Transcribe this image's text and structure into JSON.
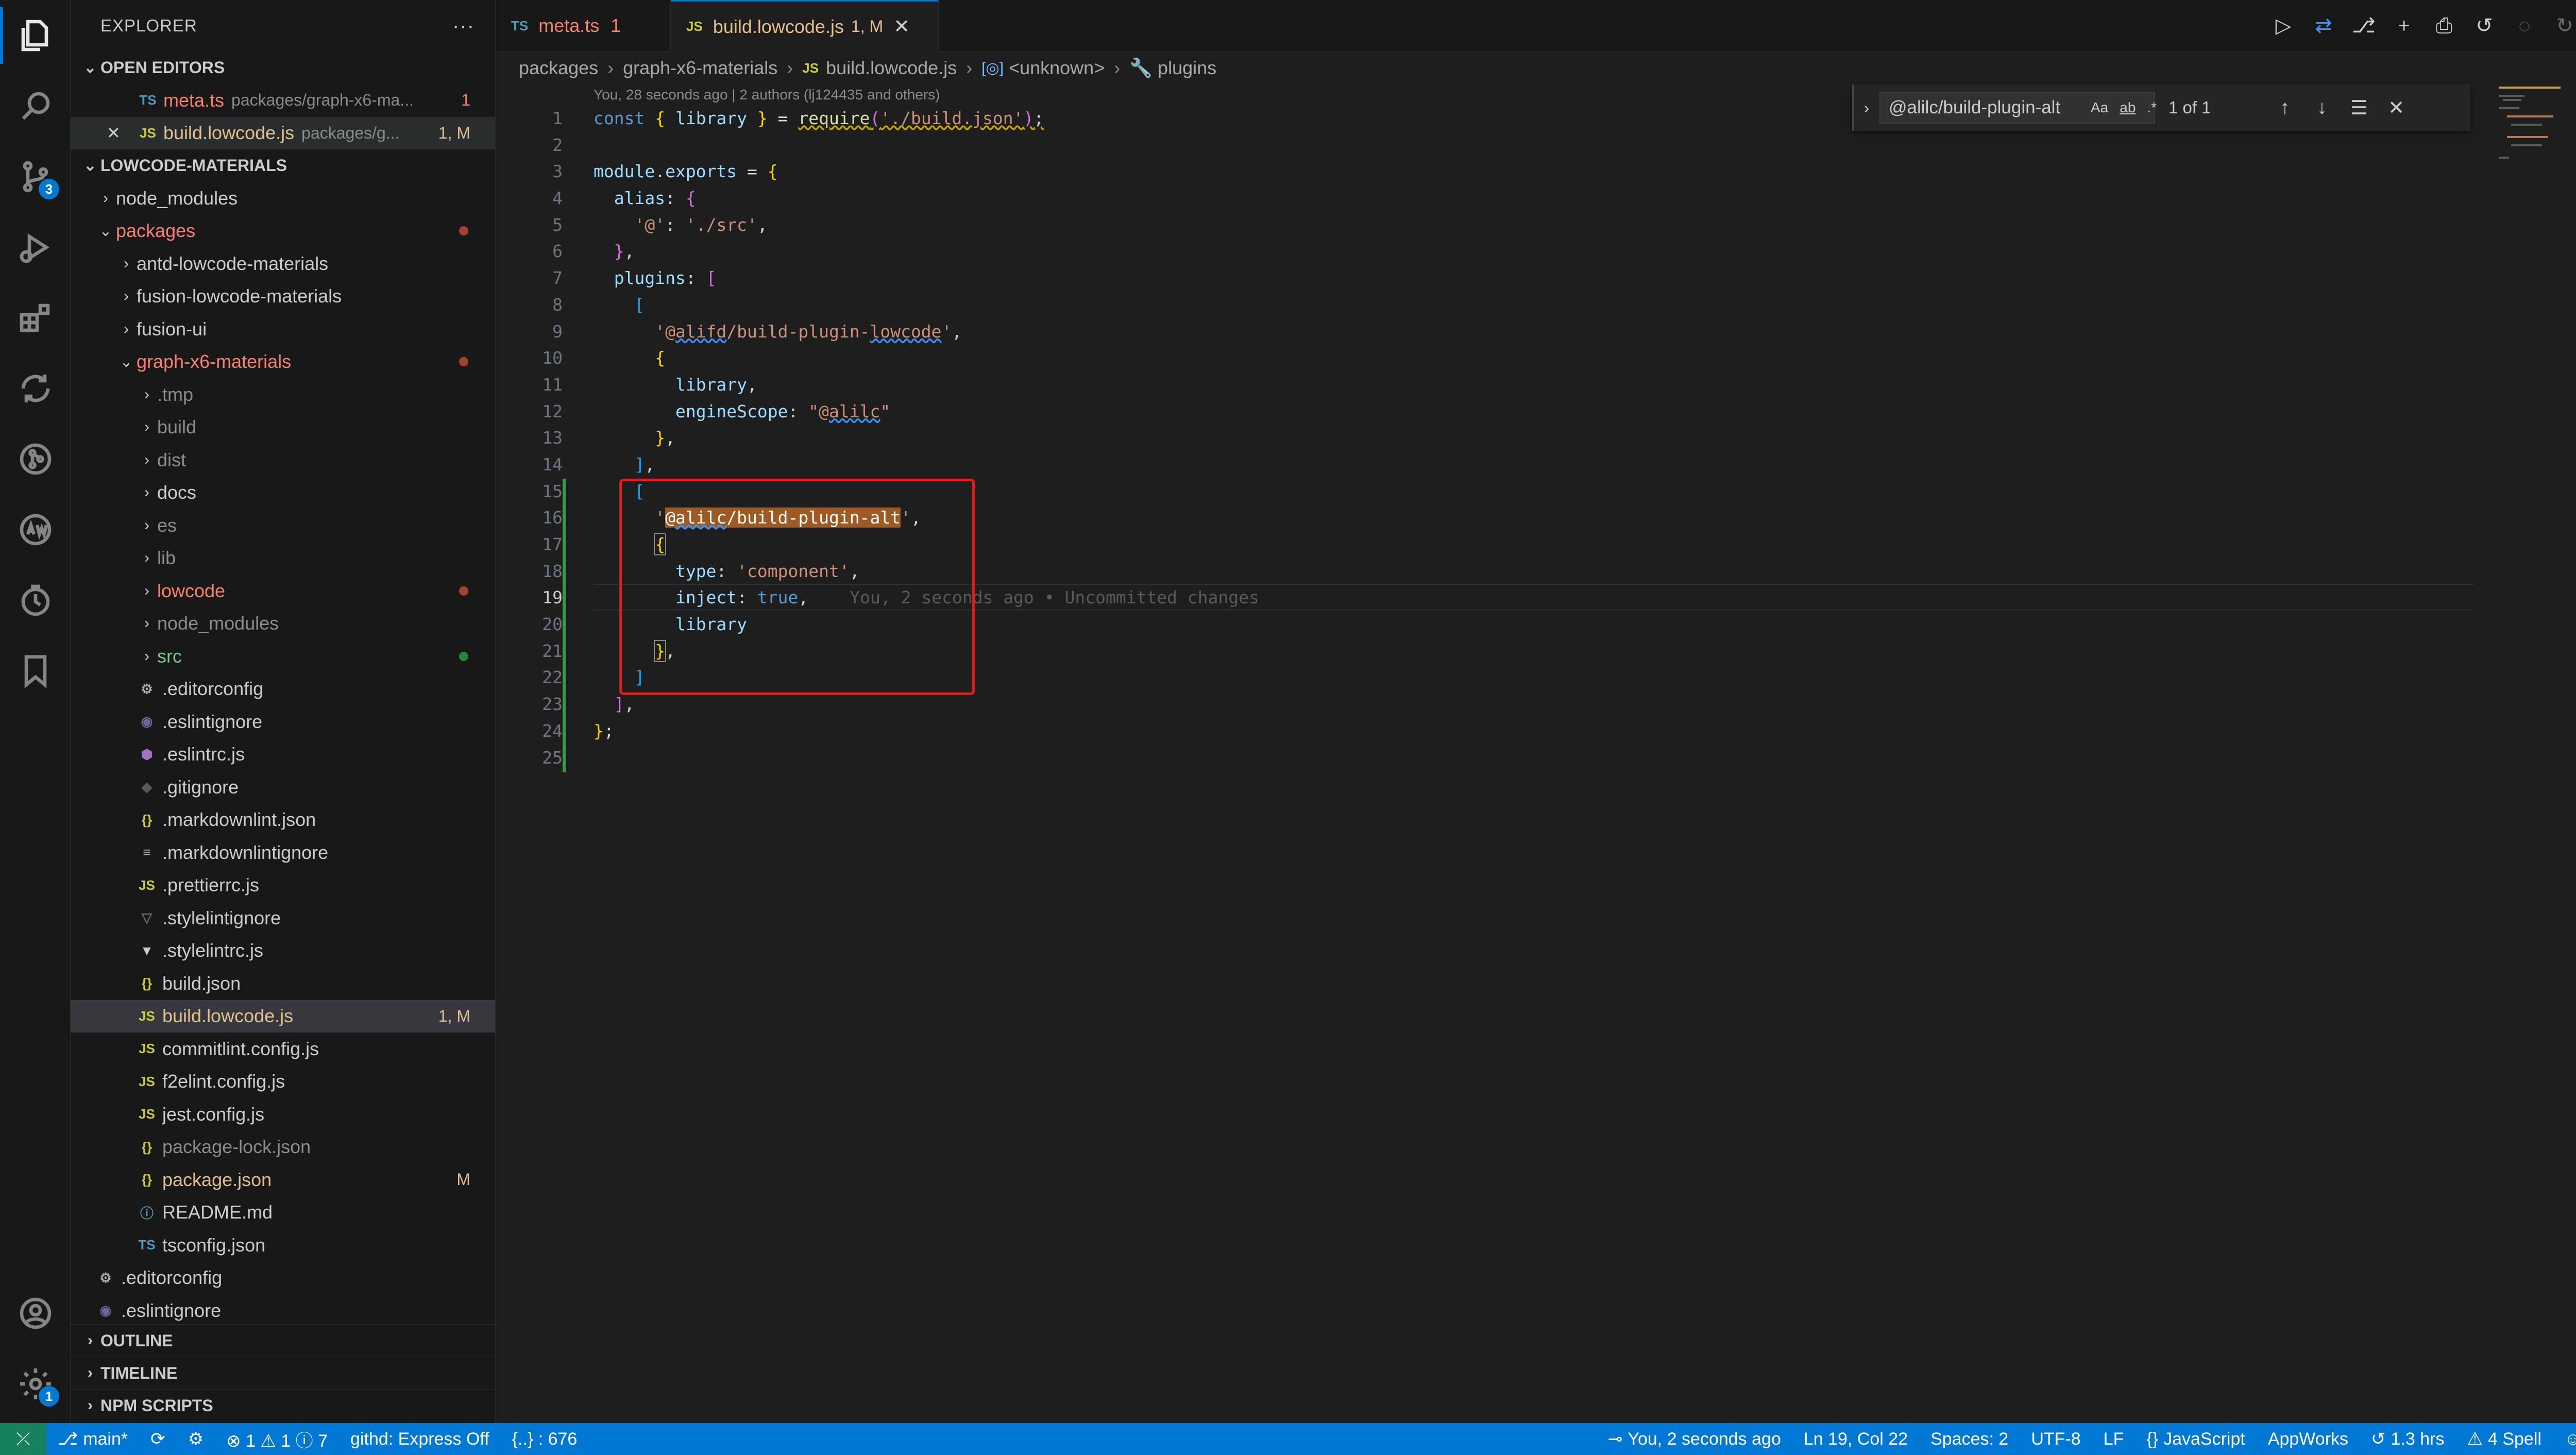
{
  "explorer": {
    "title": "EXPLORER",
    "more": "···",
    "open_editors_label": "OPEN EDITORS",
    "open_editors": [
      {
        "icon": "TS",
        "name": "meta.ts",
        "desc": "packages/graph-x6-ma...",
        "badge": "1"
      },
      {
        "icon": "JS",
        "name": "build.lowcode.js",
        "desc": "packages/g...",
        "badge": "1, M"
      }
    ],
    "root_label": "LOWCODE-MATERIALS",
    "tree": [
      {
        "name": "node_modules",
        "type": "folder",
        "depth": 0,
        "open": false
      },
      {
        "name": "packages",
        "type": "folder",
        "depth": 0,
        "open": true,
        "status": "err"
      },
      {
        "name": "antd-lowcode-materials",
        "type": "folder",
        "depth": 1,
        "open": false
      },
      {
        "name": "fusion-lowcode-materials",
        "type": "folder",
        "depth": 1,
        "open": false
      },
      {
        "name": "fusion-ui",
        "type": "folder",
        "depth": 1,
        "open": false
      },
      {
        "name": "graph-x6-materials",
        "type": "folder",
        "depth": 1,
        "open": true,
        "status": "err"
      },
      {
        "name": ".tmp",
        "type": "folder",
        "depth": 2,
        "open": false,
        "dim": true
      },
      {
        "name": "build",
        "type": "folder",
        "depth": 2,
        "open": false,
        "dim": true
      },
      {
        "name": "dist",
        "type": "folder",
        "depth": 2,
        "open": false,
        "dim": true
      },
      {
        "name": "docs",
        "type": "folder",
        "depth": 2,
        "open": false
      },
      {
        "name": "es",
        "type": "folder",
        "depth": 2,
        "open": false,
        "dim": true
      },
      {
        "name": "lib",
        "type": "folder",
        "depth": 2,
        "open": false,
        "dim": true
      },
      {
        "name": "lowcode",
        "type": "folder",
        "depth": 2,
        "open": false,
        "status": "err"
      },
      {
        "name": "node_modules",
        "type": "folder",
        "depth": 2,
        "open": false,
        "dim": true
      },
      {
        "name": "src",
        "type": "folder",
        "depth": 2,
        "open": false,
        "status": "grn"
      },
      {
        "name": ".editorconfig",
        "type": "file",
        "depth": 2,
        "icon": "⚙",
        "color": "#aaaaaa"
      },
      {
        "name": ".eslintignore",
        "type": "file",
        "depth": 2,
        "icon": "◉",
        "color": "#6a6a9a"
      },
      {
        "name": ".eslintrc.js",
        "type": "file",
        "depth": 2,
        "icon": "⬢",
        "color": "#a074c4"
      },
      {
        "name": ".gitignore",
        "type": "file",
        "depth": 2,
        "icon": "◆",
        "color": "#5a5a5a"
      },
      {
        "name": ".markdownlint.json",
        "type": "file",
        "depth": 2,
        "icon": "{}",
        "color": "#cbcb41"
      },
      {
        "name": ".markdownlintignore",
        "type": "file",
        "depth": 2,
        "icon": "≡",
        "color": "#aaaaaa"
      },
      {
        "name": ".prettierrc.js",
        "type": "file",
        "depth": 2,
        "icon": "JS",
        "color": "#cbcb41"
      },
      {
        "name": ".stylelintignore",
        "type": "file",
        "depth": 2,
        "icon": "▽",
        "color": "#6a6a6a"
      },
      {
        "name": ".stylelintrc.js",
        "type": "file",
        "depth": 2,
        "icon": "▼",
        "color": "#cccccc"
      },
      {
        "name": "build.json",
        "type": "file",
        "depth": 2,
        "icon": "{}",
        "color": "#cbcb41"
      },
      {
        "name": "build.lowcode.js",
        "type": "file",
        "depth": 2,
        "icon": "JS",
        "color": "#cbcb41",
        "status": "mod",
        "badge": "1, M",
        "selected": true
      },
      {
        "name": "commitlint.config.js",
        "type": "file",
        "depth": 2,
        "icon": "JS",
        "color": "#cbcb41"
      },
      {
        "name": "f2elint.config.js",
        "type": "file",
        "depth": 2,
        "icon": "JS",
        "color": "#cbcb41"
      },
      {
        "name": "jest.config.js",
        "type": "file",
        "depth": 2,
        "icon": "JS",
        "color": "#cbcb41"
      },
      {
        "name": "package-lock.json",
        "type": "file",
        "depth": 2,
        "icon": "{}",
        "color": "#cbcb41",
        "dim": true
      },
      {
        "name": "package.json",
        "type": "file",
        "depth": 2,
        "icon": "{}",
        "color": "#cbcb41",
        "status": "mod",
        "badge": "M"
      },
      {
        "name": "README.md",
        "type": "file",
        "depth": 2,
        "icon": "ⓘ",
        "color": "#519aba"
      },
      {
        "name": "tsconfig.json",
        "type": "file",
        "depth": 2,
        "icon": "TS",
        "color": "#519aba"
      },
      {
        "name": ".editorconfig",
        "type": "file",
        "depth": 0,
        "icon": "⚙",
        "color": "#aaaaaa"
      },
      {
        "name": ".eslintignore",
        "type": "file",
        "depth": 0,
        "icon": "◉",
        "color": "#6a6a9a"
      }
    ],
    "bottom_sections": [
      "OUTLINE",
      "TIMELINE",
      "NPM SCRIPTS"
    ]
  },
  "activity": {
    "scm_badge": "3",
    "settings_badge": "1"
  },
  "tabs": [
    {
      "icon": "TS",
      "label": "meta.ts",
      "badge": "1",
      "active": false
    },
    {
      "icon": "JS",
      "label": "build.lowcode.js",
      "badge": "1, M",
      "active": true,
      "close": "✕"
    }
  ],
  "breadcrumb": [
    "packages",
    "graph-x6-materials",
    "build.lowcode.js",
    "<unknown>",
    "plugins"
  ],
  "editor": {
    "blame_header": "You, 28 seconds ago | 2 authors (lj124435 and others)",
    "inline_blame": "You, 2 seconds ago • Uncommitted changes",
    "line_numbers": [
      "1",
      "2",
      "3",
      "4",
      "5",
      "6",
      "7",
      "8",
      "9",
      "10",
      "11",
      "12",
      "13",
      "14",
      "15",
      "16",
      "17",
      "18",
      "19",
      "20",
      "21",
      "22",
      "23",
      "24",
      "25"
    ],
    "current_line": "19"
  },
  "find": {
    "value": "@alilc/build-plugin-alt",
    "case": "Aa",
    "word": "ab",
    "regex": ".*",
    "count": "1 of 1"
  },
  "status": {
    "branch": "main*",
    "problems": "⊗ 1 ⚠ 1 ⓘ 7",
    "githd": "githd: Express Off",
    "braces": "{..} : 676",
    "blame": "You, 2 seconds ago",
    "position": "Ln 19, Col 22",
    "spaces": "Spaces: 2",
    "encoding": "UTF-8",
    "eol": "LF",
    "language": "JavaScript",
    "appworks": "AppWorks",
    "time": "1.3 hrs",
    "spell": "4 Spell"
  },
  "colors": {
    "accent": "#0078d4",
    "modified": "#e2c08d",
    "error": "#f88070",
    "added": "#73c991",
    "highlight_box": "#e51a1a"
  }
}
